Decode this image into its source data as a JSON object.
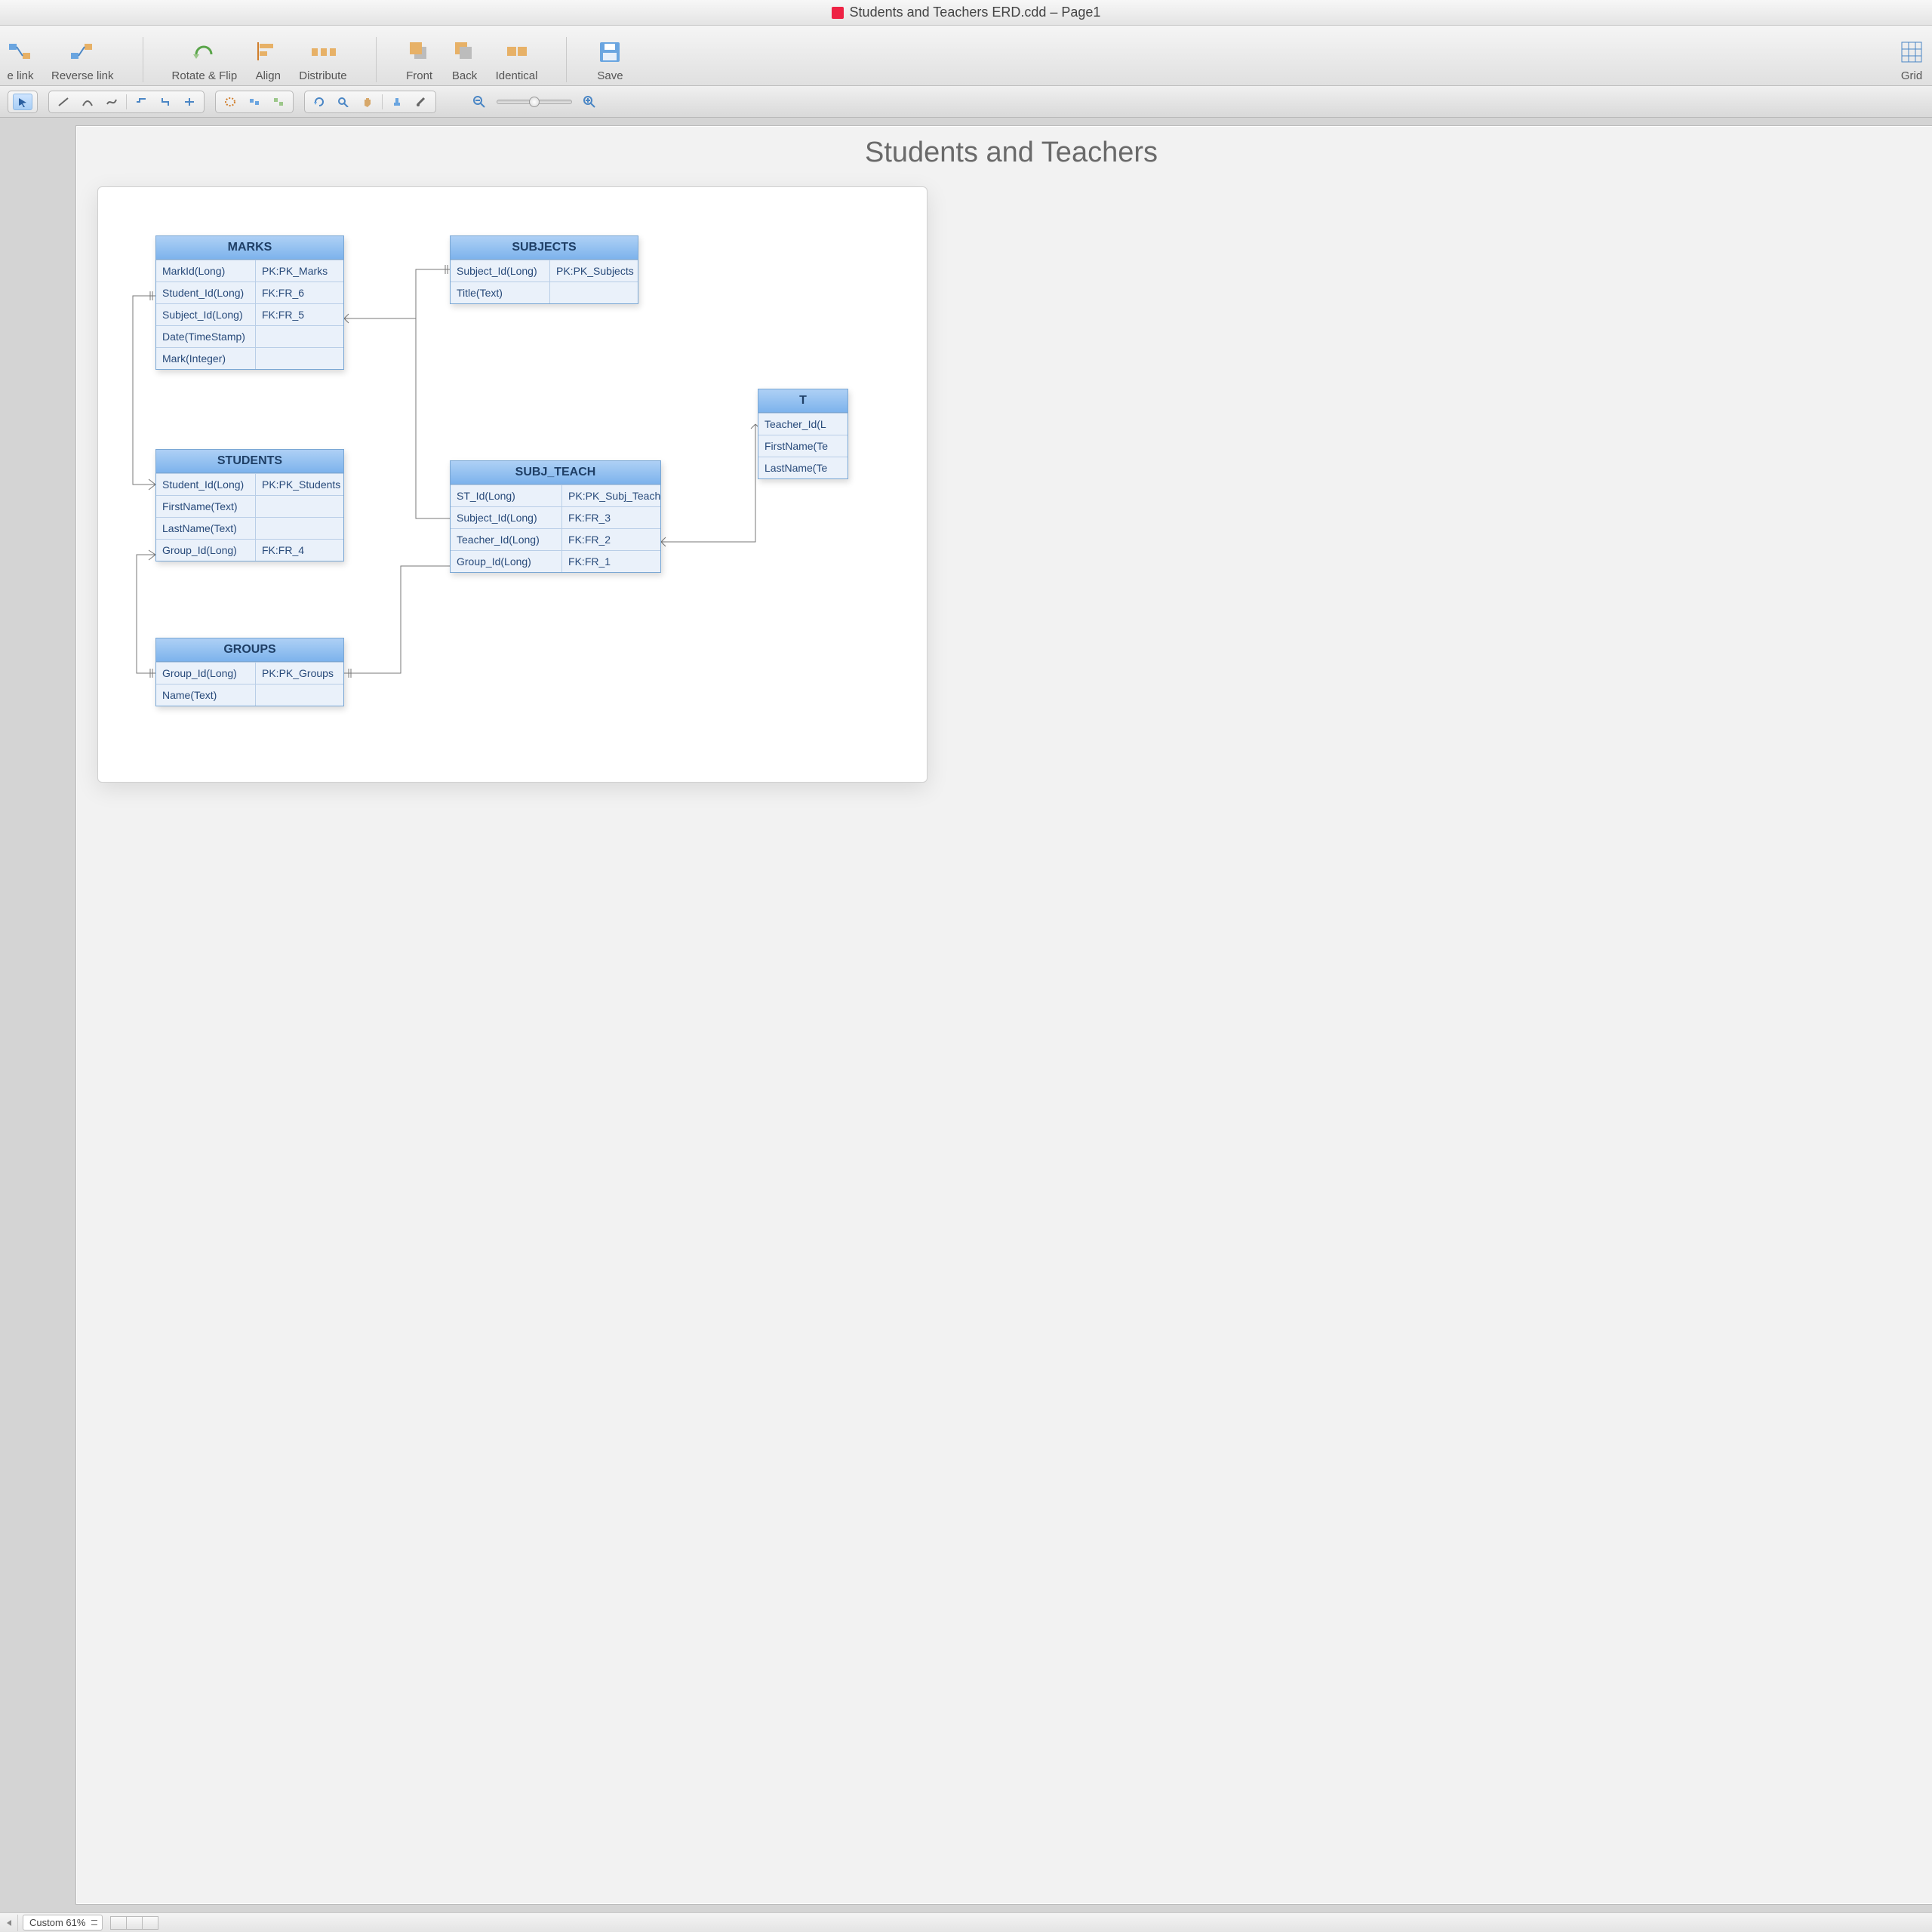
{
  "window": {
    "title": "Students and Teachers ERD.cdd – Page1"
  },
  "toolbar": {
    "buttons": [
      {
        "id": "makelink",
        "label": "e link"
      },
      {
        "id": "reverselink",
        "label": "Reverse link"
      },
      {
        "id": "rotateflip",
        "label": "Rotate & Flip"
      },
      {
        "id": "align",
        "label": "Align"
      },
      {
        "id": "distribute",
        "label": "Distribute"
      },
      {
        "id": "front",
        "label": "Front"
      },
      {
        "id": "back",
        "label": "Back"
      },
      {
        "id": "identical",
        "label": "Identical"
      },
      {
        "id": "save",
        "label": "Save"
      },
      {
        "id": "grid",
        "label": "Grid"
      }
    ]
  },
  "statusbar": {
    "zoom_label": "Custom 61%"
  },
  "diagram": {
    "title": "Students and Teachers",
    "entities": {
      "marks": {
        "title": "MARKS",
        "rows": [
          {
            "c1": "MarkId(Long)",
            "c2": "PK:PK_Marks"
          },
          {
            "c1": "Student_Id(Long)",
            "c2": "FK:FR_6"
          },
          {
            "c1": "Subject_Id(Long)",
            "c2": "FK:FR_5"
          },
          {
            "c1": "Date(TimeStamp)",
            "c2": ""
          },
          {
            "c1": "Mark(Integer)",
            "c2": ""
          }
        ]
      },
      "subjects": {
        "title": "SUBJECTS",
        "rows": [
          {
            "c1": "Subject_Id(Long)",
            "c2": "PK:PK_Subjects"
          },
          {
            "c1": "Title(Text)",
            "c2": ""
          }
        ]
      },
      "students": {
        "title": "STUDENTS",
        "rows": [
          {
            "c1": "Student_Id(Long)",
            "c2": "PK:PK_Students"
          },
          {
            "c1": "FirstName(Text)",
            "c2": ""
          },
          {
            "c1": "LastName(Text)",
            "c2": ""
          },
          {
            "c1": "Group_Id(Long)",
            "c2": "FK:FR_4"
          }
        ]
      },
      "subjteach": {
        "title": "SUBJ_TEACH",
        "rows": [
          {
            "c1": "ST_Id(Long)",
            "c2": "PK:PK_Subj_Teach"
          },
          {
            "c1": "Subject_Id(Long)",
            "c2": "FK:FR_3"
          },
          {
            "c1": "Teacher_Id(Long)",
            "c2": "FK:FR_2"
          },
          {
            "c1": "Group_Id(Long)",
            "c2": "FK:FR_1"
          }
        ]
      },
      "groups": {
        "title": "GROUPS",
        "rows": [
          {
            "c1": "Group_Id(Long)",
            "c2": "PK:PK_Groups"
          },
          {
            "c1": "Name(Text)",
            "c2": ""
          }
        ]
      },
      "teachers": {
        "title": "T",
        "rows": [
          {
            "c1": "Teacher_Id(L",
            "c2": ""
          },
          {
            "c1": "FirstName(Te",
            "c2": ""
          },
          {
            "c1": "LastName(Te",
            "c2": ""
          }
        ]
      }
    }
  }
}
